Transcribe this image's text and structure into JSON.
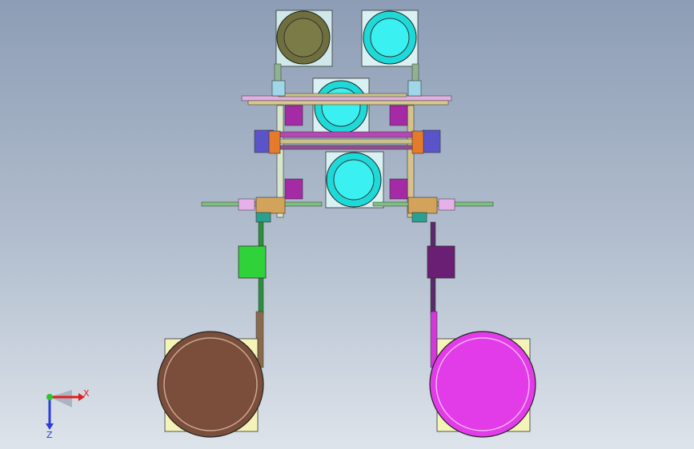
{
  "view": {
    "background_top": "#8d9db5",
    "background_bottom": "#dde3ea"
  },
  "triad": {
    "x_label": "X",
    "z_label": "Z",
    "x_color": "#e02020",
    "y_color": "#2ec42e",
    "z_color": "#2a3dd8"
  },
  "colors": {
    "plate": "#f5f4b8",
    "cyan_bowl": "#22e6e6",
    "olive_bowl": "#7b7b48",
    "brown_bowl": "#7a4e3b",
    "magenta_bowl": "#e23be8",
    "green_block": "#30d23a",
    "purple_block": "#6a1e74",
    "magenta_block": "#a52aa5",
    "rail": "#c9c28a",
    "track_brown": "#8a6a4c",
    "track_green": "#2b8f3c",
    "track_purple": "#5a2a6a",
    "track_magenta": "#d03ad6"
  }
}
